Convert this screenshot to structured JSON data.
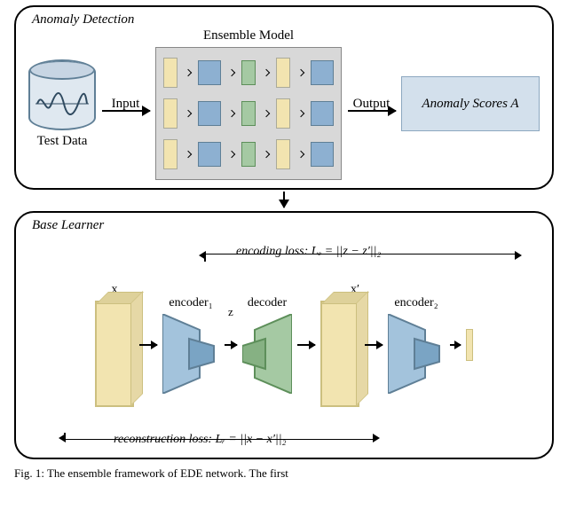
{
  "panels": {
    "top_title": "Anomaly Detection",
    "bottom_title": "Base Learner"
  },
  "top": {
    "test_data_label": "Test Data",
    "input_label": "Input",
    "ensemble_label": "Ensemble Model",
    "output_label": "Output",
    "scores_label": "Anomaly Scores A"
  },
  "bottom": {
    "x_label": "x",
    "encoder1_label": "encoder₁",
    "z_label": "z",
    "decoder_label": "decoder",
    "x_prime_label": "x′",
    "encoder2_label": "encoder₂",
    "encoding_loss": "encoding loss:  Lₑ = ||z − z′||₂",
    "reconstruction_loss": "reconstruction loss:  Lᵣ = ||x − x′||₂"
  },
  "caption": "Fig. 1:  The  ensemble  framework  of  EDE  network.  The  first"
}
